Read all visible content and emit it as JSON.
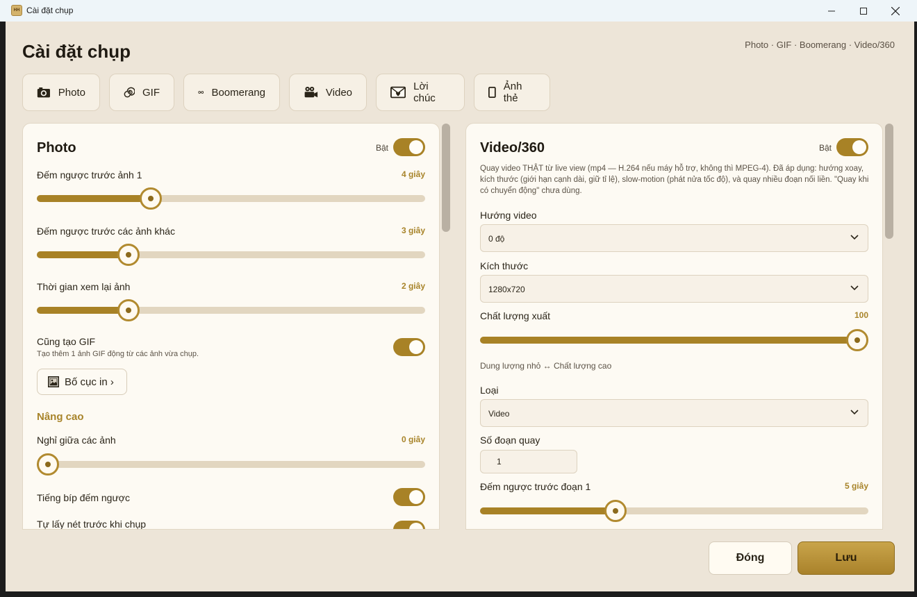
{
  "window": {
    "title": "Cài đặt chụp",
    "app_icon_text": "HH"
  },
  "header": {
    "title": "Cài đặt chụp",
    "tagline": "Photo · GIF · Boomerang · Video/360"
  },
  "tabs": [
    {
      "label": "Photo",
      "icon": "camera-icon"
    },
    {
      "label": "GIF",
      "icon": "spiral-icon"
    },
    {
      "label": "Boomerang",
      "icon": "infinity-icon"
    },
    {
      "label": "Video",
      "icon": "video-camera-icon"
    },
    {
      "label": "Lời chúc",
      "icon": "love-letter-icon"
    },
    {
      "label": "Ảnh thẻ",
      "icon": "portrait-card-icon"
    }
  ],
  "photo": {
    "title": "Photo",
    "enabled_label": "Bật",
    "enabled": true,
    "countdown_first": {
      "label": "Đếm ngược trước ảnh 1",
      "value": "4 giây",
      "fraction": 0.28
    },
    "countdown_others": {
      "label": "Đếm ngược trước các ảnh khác",
      "value": "3 giây",
      "fraction": 0.22
    },
    "review_time": {
      "label": "Thời gian xem lại ảnh",
      "value": "2 giây",
      "fraction": 0.22
    },
    "also_gif": {
      "label": "Cũng tạo GIF",
      "desc": "Tạo thêm 1 ảnh GIF động từ các ảnh vừa chụp.",
      "on": true
    },
    "layout_button": "Bố cục in ›",
    "advanced": {
      "heading": "Nâng cao",
      "pause_between": {
        "label": "Nghỉ giữa các ảnh",
        "value": "0 giây",
        "fraction": 0.0
      },
      "beep_countdown": {
        "label": "Tiếng bíp đếm ngược",
        "on": true
      },
      "autofocus": {
        "label": "Tự lấy nét trước khi chụp",
        "on": true
      }
    }
  },
  "video": {
    "title": "Video/360",
    "enabled_label": "Bật",
    "enabled": true,
    "description": "Quay video THẬT từ live view (mp4 — H.264 nếu máy hỗ trợ, không thì MPEG-4). Đã áp dụng: hướng xoay, kích thước (giới hạn cạnh dài, giữ tỉ lệ), slow-motion (phát nửa tốc độ), và quay nhiều đoạn nối liền. \"Quay khi có chuyển động\" chưa dùng.",
    "orientation": {
      "label": "Hướng video",
      "value": "0 độ"
    },
    "size": {
      "label": "Kích thước",
      "value": "1280x720"
    },
    "quality": {
      "label": "Chất lượng xuất",
      "value": "100",
      "fraction": 1.0,
      "hint": "Dung lượng nhỏ ↔ Chất lượng cao"
    },
    "type": {
      "label": "Loại",
      "value": "Video"
    },
    "segments": {
      "label": "Số đoạn quay",
      "value": "1"
    },
    "countdown_first": {
      "label": "Đếm ngược trước đoạn 1",
      "value": "5 giây",
      "fraction": 0.34
    }
  },
  "footer": {
    "close_label": "Đóng",
    "save_label": "Lưu"
  },
  "colors": {
    "accent": "#a88226",
    "background": "#ede5d8",
    "panel": "#fdfaf3"
  }
}
